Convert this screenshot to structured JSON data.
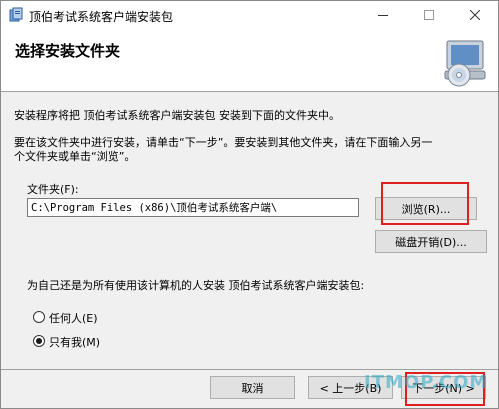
{
  "window": {
    "title": "顶伯考试系统客户端安装包",
    "minimize_icon": "minimize-icon",
    "maximize_icon": "maximize-icon",
    "close_icon": "close-icon"
  },
  "header": {
    "title": "选择安装文件夹",
    "icon": "cd-computer-icon"
  },
  "main": {
    "intro": "安装程序将把 顶伯考试系统客户端安装包 安装到下面的文件夹中。",
    "instruction_line1": "要在该文件夹中进行安装，请单击“下一步”。要安装到其他文件夹，请在下面输入另一",
    "instruction_line2": "个文件夹或单击“浏览”。",
    "folder_label": "文件夹(F):",
    "folder_value": "C:\\Program Files (x86)\\顶伯考试系统客户端\\",
    "browse_label": "浏览(R)...",
    "disk_cost_label": "磁盘开销(D)...",
    "install_for_question": "为自己还是为所有使用该计算机的人安装 顶伯考试系统客户端安装包:",
    "options": [
      {
        "label": "任何人(E)",
        "selected": false
      },
      {
        "label": "只有我(M)",
        "selected": true
      }
    ]
  },
  "footer": {
    "cancel_label": "取消",
    "back_label": "< 上一步(B)",
    "next_label": "下一步(N) >"
  },
  "watermark": "ITMOP.COM",
  "colors": {
    "highlight": "#e02020",
    "window_bg": "#f0f0f0",
    "accent": "#0078d7"
  }
}
